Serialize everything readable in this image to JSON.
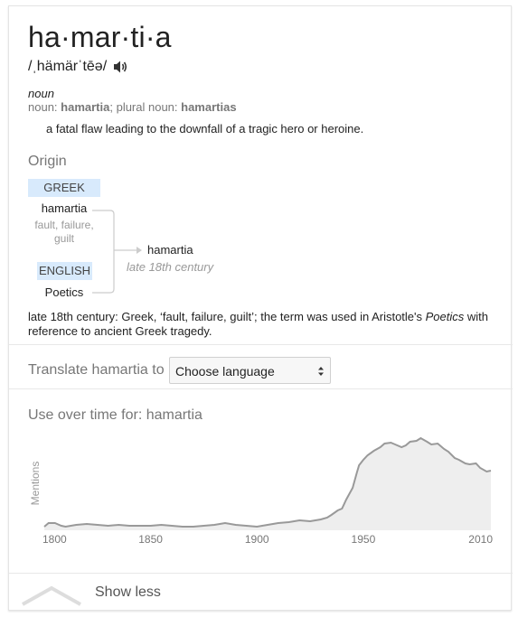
{
  "entry": {
    "headword": "ha·mar·ti·a",
    "pronunciation": "/ˌhämärˈtēə/",
    "part_of_speech": "noun",
    "forms_prefix": "noun: ",
    "form_singular": "hamartia",
    "forms_plural_prefix": "; plural noun: ",
    "form_plural": "hamartias",
    "definition": "a fatal flaw leading to the downfall of a tragic hero or heroine."
  },
  "origin": {
    "title": "Origin",
    "greek_label": "GREEK",
    "greek_word": "hamartia",
    "greek_gloss_line1": "fault, failure,",
    "greek_gloss_line2": "guilt",
    "english_label": "ENGLISH",
    "english_word": "Poetics",
    "result_word": "hamartia",
    "result_date": "late 18th century",
    "text_before": "late 18th century: Greek, ‘fault, failure, guilt’; the term was used in Aristotle's ",
    "text_italic": "Poetics",
    "text_after": " with reference to ancient Greek tragedy."
  },
  "translate": {
    "label": "Translate hamartia to",
    "select_value": "Choose language"
  },
  "usage": {
    "title": "Use over time for: hamartia"
  },
  "footer": {
    "show_less": "Show less"
  },
  "colors": {
    "badge_bg": "#d8eafc",
    "chart_line": "#999999",
    "chart_fill": "#eeeeee"
  },
  "chart_data": {
    "type": "area",
    "title": "Use over time for: hamartia",
    "ylabel": "Mentions",
    "xlabel": "",
    "xlim": [
      1800,
      2010
    ],
    "x_ticks": [
      1800,
      1850,
      1900,
      1950,
      2010
    ],
    "grid": false,
    "series": [
      {
        "values_x": [
          1800,
          1802,
          1805,
          1808,
          1810,
          1815,
          1820,
          1825,
          1830,
          1835,
          1840,
          1845,
          1850,
          1855,
          1860,
          1865,
          1870,
          1875,
          1880,
          1885,
          1890,
          1895,
          1900,
          1905,
          1910,
          1915,
          1920,
          1925,
          1930,
          1933,
          1935,
          1938,
          1940,
          1942,
          1945,
          1947,
          1948,
          1950,
          1952,
          1955,
          1958,
          1960,
          1963,
          1965,
          1968,
          1970,
          1972,
          1975,
          1977,
          1980,
          1982,
          1985,
          1988,
          1990,
          1993,
          1995,
          1998,
          2000,
          2003,
          2005,
          2008,
          2010
        ],
        "values_y": [
          0.02,
          0.06,
          0.06,
          0.03,
          0.02,
          0.04,
          0.05,
          0.04,
          0.03,
          0.04,
          0.03,
          0.03,
          0.03,
          0.04,
          0.03,
          0.02,
          0.02,
          0.03,
          0.04,
          0.06,
          0.04,
          0.03,
          0.02,
          0.04,
          0.06,
          0.07,
          0.09,
          0.08,
          0.1,
          0.12,
          0.15,
          0.2,
          0.22,
          0.32,
          0.45,
          0.62,
          0.7,
          0.76,
          0.81,
          0.86,
          0.9,
          0.94,
          0.95,
          0.93,
          0.9,
          0.92,
          0.96,
          0.97,
          1.0,
          0.96,
          0.93,
          0.94,
          0.88,
          0.85,
          0.78,
          0.76,
          0.72,
          0.71,
          0.72,
          0.67,
          0.63,
          0.64
        ]
      }
    ]
  }
}
